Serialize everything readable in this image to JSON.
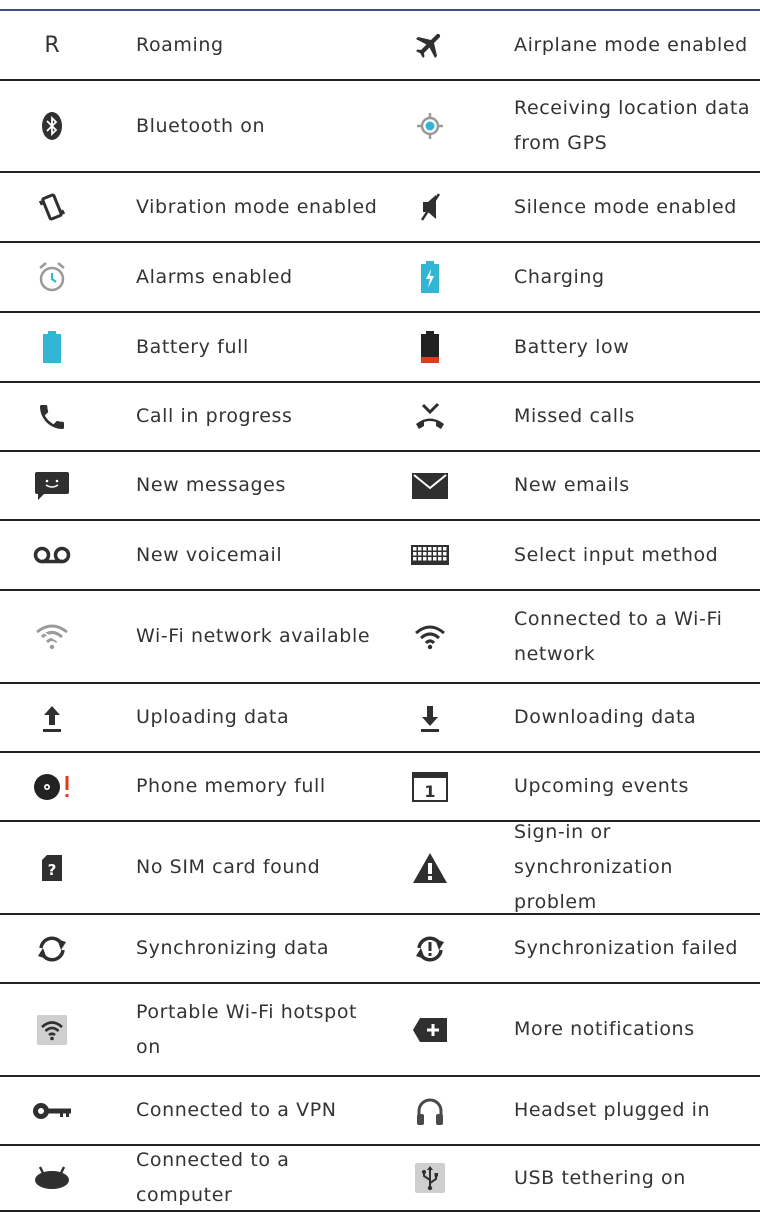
{
  "colors": {
    "rule": "#3a4f8f",
    "accent": "#33b5d4",
    "red": "#e03c1a",
    "dark": "#2f2f2f",
    "gray": "#9a9a9a"
  },
  "rows": [
    {
      "left": {
        "icon": "roaming-icon",
        "glyph": "R",
        "label": "Roaming"
      },
      "right": {
        "icon": "airplane-icon",
        "label": "Airplane mode enabled"
      }
    },
    {
      "left": {
        "icon": "bluetooth-icon",
        "label": "Bluetooth on"
      },
      "right": {
        "icon": "gps-icon",
        "label": "Receiving location data from GPS"
      }
    },
    {
      "left": {
        "icon": "vibration-icon",
        "label": "Vibration mode enabled"
      },
      "right": {
        "icon": "silence-icon",
        "label": "Silence mode enabled"
      }
    },
    {
      "left": {
        "icon": "alarm-icon",
        "label": "Alarms enabled"
      },
      "right": {
        "icon": "charging-icon",
        "label": "Charging"
      }
    },
    {
      "left": {
        "icon": "battery-full-icon",
        "label": "Battery full"
      },
      "right": {
        "icon": "battery-low-icon",
        "label": "Battery low"
      }
    },
    {
      "left": {
        "icon": "call-icon",
        "label": "Call in progress"
      },
      "right": {
        "icon": "missed-call-icon",
        "label": "Missed calls"
      }
    },
    {
      "left": {
        "icon": "message-icon",
        "label": "New messages"
      },
      "right": {
        "icon": "email-icon",
        "label": "New emails"
      }
    },
    {
      "left": {
        "icon": "voicemail-icon",
        "label": "New voicemail"
      },
      "right": {
        "icon": "keyboard-icon",
        "label": "Select input method"
      }
    },
    {
      "left": {
        "icon": "wifi-available-icon",
        "label": "Wi-Fi network available"
      },
      "right": {
        "icon": "wifi-connected-icon",
        "label": "Connected to a Wi-Fi network"
      }
    },
    {
      "left": {
        "icon": "upload-icon",
        "label": "Uploading data"
      },
      "right": {
        "icon": "download-icon",
        "label": "Downloading data"
      }
    },
    {
      "left": {
        "icon": "memory-full-icon",
        "label": "Phone memory full"
      },
      "right": {
        "icon": "calendar-icon",
        "glyph": "1",
        "label": "Upcoming events"
      }
    },
    {
      "left": {
        "icon": "no-sim-icon",
        "glyph": "?",
        "label": "No SIM card found"
      },
      "right": {
        "icon": "warning-icon",
        "label": "Sign-in or synchronization problem"
      }
    },
    {
      "left": {
        "icon": "sync-icon",
        "label": "Synchronizing data"
      },
      "right": {
        "icon": "sync-failed-icon",
        "label": "Synchronization failed"
      }
    },
    {
      "left": {
        "icon": "hotspot-icon",
        "label": "Portable Wi-Fi hotspot on"
      },
      "right": {
        "icon": "more-notifications-icon",
        "label": "More notifications"
      }
    },
    {
      "left": {
        "icon": "vpn-key-icon",
        "label": "Connected to a VPN"
      },
      "right": {
        "icon": "headset-icon",
        "label": "Headset plugged in"
      }
    },
    {
      "left": {
        "icon": "computer-connection-icon",
        "label": "Connected to a computer"
      },
      "right": {
        "icon": "usb-icon",
        "label": "USB tethering on"
      }
    }
  ]
}
